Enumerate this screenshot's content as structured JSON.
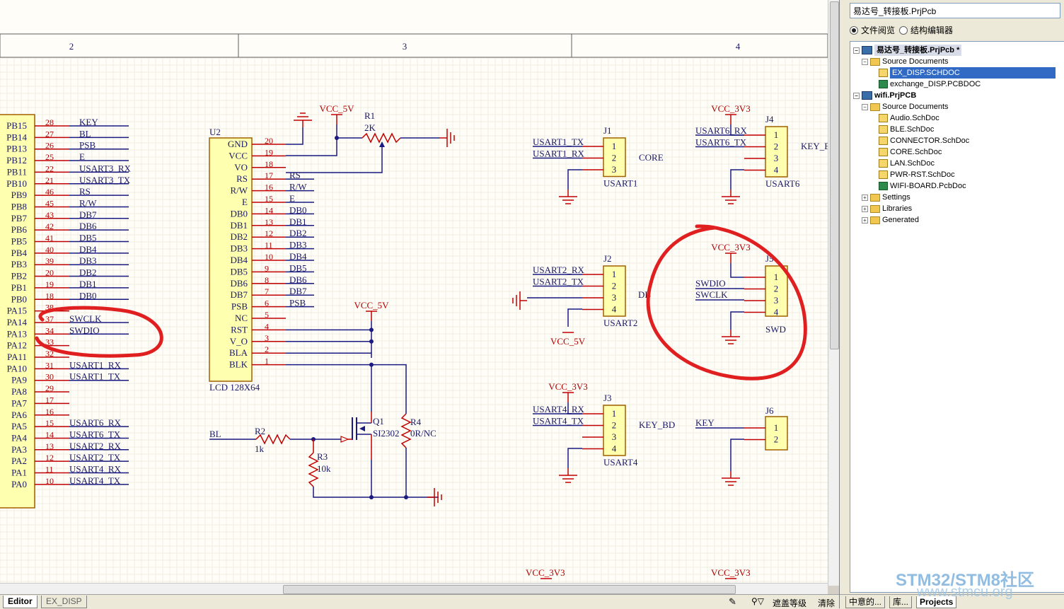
{
  "schematic": {
    "zone_labels": [
      "2",
      "3",
      "4"
    ],
    "mcu_pins": [
      {
        "name": "PB15",
        "num": "28",
        "net": "KEY"
      },
      {
        "name": "PB14",
        "num": "27",
        "net": "BL"
      },
      {
        "name": "PB13",
        "num": "26",
        "net": "PSB"
      },
      {
        "name": "PB12",
        "num": "25",
        "net": "E"
      },
      {
        "name": "PB11",
        "num": "22",
        "net": "USART3_RX"
      },
      {
        "name": "PB10",
        "num": "21",
        "net": "USART3_TX"
      },
      {
        "name": "PB9",
        "num": "46",
        "net": "RS"
      },
      {
        "name": "PB8",
        "num": "45",
        "net": "R/W"
      },
      {
        "name": "PB7",
        "num": "43",
        "net": "DB7"
      },
      {
        "name": "PB6",
        "num": "42",
        "net": "DB6"
      },
      {
        "name": "PB5",
        "num": "41",
        "net": "DB5"
      },
      {
        "name": "PB4",
        "num": "40",
        "net": "DB4"
      },
      {
        "name": "PB3",
        "num": "39",
        "net": "DB3"
      },
      {
        "name": "PB2",
        "num": "20",
        "net": "DB2"
      },
      {
        "name": "PB1",
        "num": "19",
        "net": "DB1"
      },
      {
        "name": "PB0",
        "num": "18",
        "net": "DB0"
      },
      {
        "name": "PA15",
        "num": "38",
        "net": ""
      },
      {
        "name": "PA14",
        "num": "37",
        "net": "SWCLK"
      },
      {
        "name": "PA13",
        "num": "34",
        "net": "SWDIO"
      },
      {
        "name": "PA12",
        "num": "33",
        "net": ""
      },
      {
        "name": "PA11",
        "num": "32",
        "net": ""
      },
      {
        "name": "PA10",
        "num": "31",
        "net": "USART1_RX"
      },
      {
        "name": "PA9",
        "num": "30",
        "net": "USART1_TX"
      },
      {
        "name": "PA8",
        "num": "29",
        "net": ""
      },
      {
        "name": "PA7",
        "num": "17",
        "net": ""
      },
      {
        "name": "PA6",
        "num": "16",
        "net": ""
      },
      {
        "name": "PA5",
        "num": "15",
        "net": "USART6_RX"
      },
      {
        "name": "PA4",
        "num": "14",
        "net": "USART6_TX"
      },
      {
        "name": "PA3",
        "num": "13",
        "net": "USART2_RX"
      },
      {
        "name": "PA2",
        "num": "12",
        "net": "USART2_TX"
      },
      {
        "name": "PA1",
        "num": "11",
        "net": "USART4_RX"
      },
      {
        "name": "PA0",
        "num": "10",
        "net": "USART4_TX"
      }
    ],
    "lcd": {
      "ref": "U2",
      "name": "LCD 128X64",
      "pins": [
        {
          "name": "GND",
          "num": "20",
          "net": ""
        },
        {
          "name": "VCC",
          "num": "19",
          "net": ""
        },
        {
          "name": "VO",
          "num": "18",
          "net": ""
        },
        {
          "name": "RS",
          "num": "17",
          "net": "RS"
        },
        {
          "name": "R/W",
          "num": "16",
          "net": "R/W"
        },
        {
          "name": "E",
          "num": "15",
          "net": "E"
        },
        {
          "name": "DB0",
          "num": "14",
          "net": "DB0"
        },
        {
          "name": "DB1",
          "num": "13",
          "net": "DB1"
        },
        {
          "name": "DB2",
          "num": "12",
          "net": "DB2"
        },
        {
          "name": "DB3",
          "num": "11",
          "net": "DB3"
        },
        {
          "name": "DB4",
          "num": "10",
          "net": "DB4"
        },
        {
          "name": "DB5",
          "num": "9",
          "net": "DB5"
        },
        {
          "name": "DB6",
          "num": "8",
          "net": "DB6"
        },
        {
          "name": "DB7",
          "num": "7",
          "net": "DB7"
        },
        {
          "name": "PSB",
          "num": "6",
          "net": "PSB"
        },
        {
          "name": "NC",
          "num": "5",
          "net": ""
        },
        {
          "name": "RST",
          "num": "4",
          "net": ""
        },
        {
          "name": "V_O",
          "num": "3",
          "net": ""
        },
        {
          "name": "BLA",
          "num": "2",
          "net": ""
        },
        {
          "name": "BLK",
          "num": "1",
          "net": ""
        }
      ]
    },
    "labels": {
      "vcc5v": "VCC_5V",
      "vcc3v3": "VCC_3V3",
      "r1": "R1",
      "r1_val": "2K",
      "r2": "R2",
      "r2_val": "1k",
      "r3": "R3",
      "r3_val": "10k",
      "r4": "R4",
      "r4_val": "0R/NC",
      "q1": "Q1",
      "q1_val": "SI2302",
      "bl": "BL",
      "key": "KEY",
      "db": "DB"
    },
    "connectors": [
      {
        "ref": "J1",
        "name": "USART1",
        "side": "CORE",
        "nets": [
          "USART1_TX",
          "USART1_RX"
        ],
        "pins": [
          "1",
          "2",
          "3"
        ]
      },
      {
        "ref": "J4",
        "name": "USART6",
        "side": "KEY_B",
        "nets": [
          "USART6_RX",
          "USART6_TX"
        ],
        "pins": [
          "1",
          "2",
          "3",
          "4"
        ]
      },
      {
        "ref": "J2",
        "name": "USART2",
        "side": "",
        "nets": [
          "USART2_RX",
          "USART2_TX"
        ],
        "pins": [
          "1",
          "2",
          "3",
          "4"
        ]
      },
      {
        "ref": "J5",
        "name": "SWD",
        "side": "",
        "nets": [
          "SWDIO",
          "SWCLK"
        ],
        "pins": [
          "1",
          "2",
          "3",
          "4"
        ]
      },
      {
        "ref": "J3",
        "name": "USART4",
        "side": "KEY_BD",
        "nets": [
          "USART4_RX",
          "USART4_TX"
        ],
        "pins": [
          "1",
          "2",
          "3",
          "4"
        ]
      },
      {
        "ref": "J6",
        "name": "",
        "side": "",
        "nets": [
          "KEY"
        ],
        "pins": [
          "1",
          "2"
        ]
      }
    ],
    "colors": {
      "wire": "#1a1a80",
      "pin": "#c00000",
      "body": "#ffffb0",
      "annotation": "#e02020"
    }
  },
  "editor_tabs": [
    "Editor",
    "EX_DISP"
  ],
  "status": {
    "mask_level": "遮盖等级",
    "clear": "清除"
  },
  "panel": {
    "project_dropdown": "易达号_转接板.PrjPcb",
    "radio_file_view": "文件阅览",
    "radio_struct_editor": "结构编辑器",
    "tree": {
      "proj1": "易达号_转接板.PrjPcb *",
      "proj1_source": "Source Documents",
      "proj1_doc1": "EX_DISP.SCHDOC",
      "proj1_doc2": "exchange_DISP.PCBDOC",
      "proj2": "wifi.PrjPCB",
      "proj2_source": "Source Documents",
      "proj2_docs": [
        "Audio.SchDoc",
        "BLE.SchDoc",
        "CONNECTOR.SchDoc",
        "CORE.SchDoc",
        "LAN.SchDoc",
        "PWR-RST.SchDoc",
        "WIFI-BOARD.PcbDoc"
      ],
      "settings": "Settings",
      "libraries": "Libraries",
      "generated": "Generated"
    },
    "bottom_tabs": [
      "中意的...",
      "库...",
      "Projects"
    ]
  },
  "watermark": {
    "line1": "STM32/STM8社区",
    "line2": "www.stmcu.org"
  }
}
